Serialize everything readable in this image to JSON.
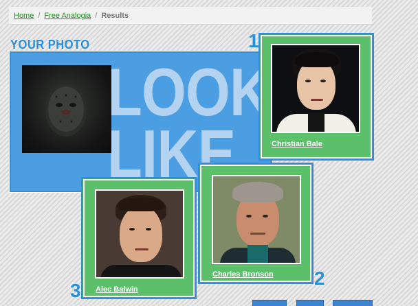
{
  "breadcrumb": {
    "home": "Home",
    "separator": "/",
    "section": "Free Analogia",
    "current": "Results"
  },
  "your_photo": {
    "title": "YOUR PHOTO",
    "banner_line1": "LOOK",
    "banner_line2": "LIKE"
  },
  "matches": [
    {
      "rank": "1",
      "name": "Christian Bale"
    },
    {
      "rank": "2",
      "name": "Charles Bronson"
    },
    {
      "rank": "3",
      "name": "Alec Balwin"
    }
  ],
  "colors": {
    "accent_blue": "#2a8fd6",
    "panel_blue": "#4b9ee1",
    "card_green": "#5cbf6a",
    "link_green": "#1f8a1f"
  }
}
